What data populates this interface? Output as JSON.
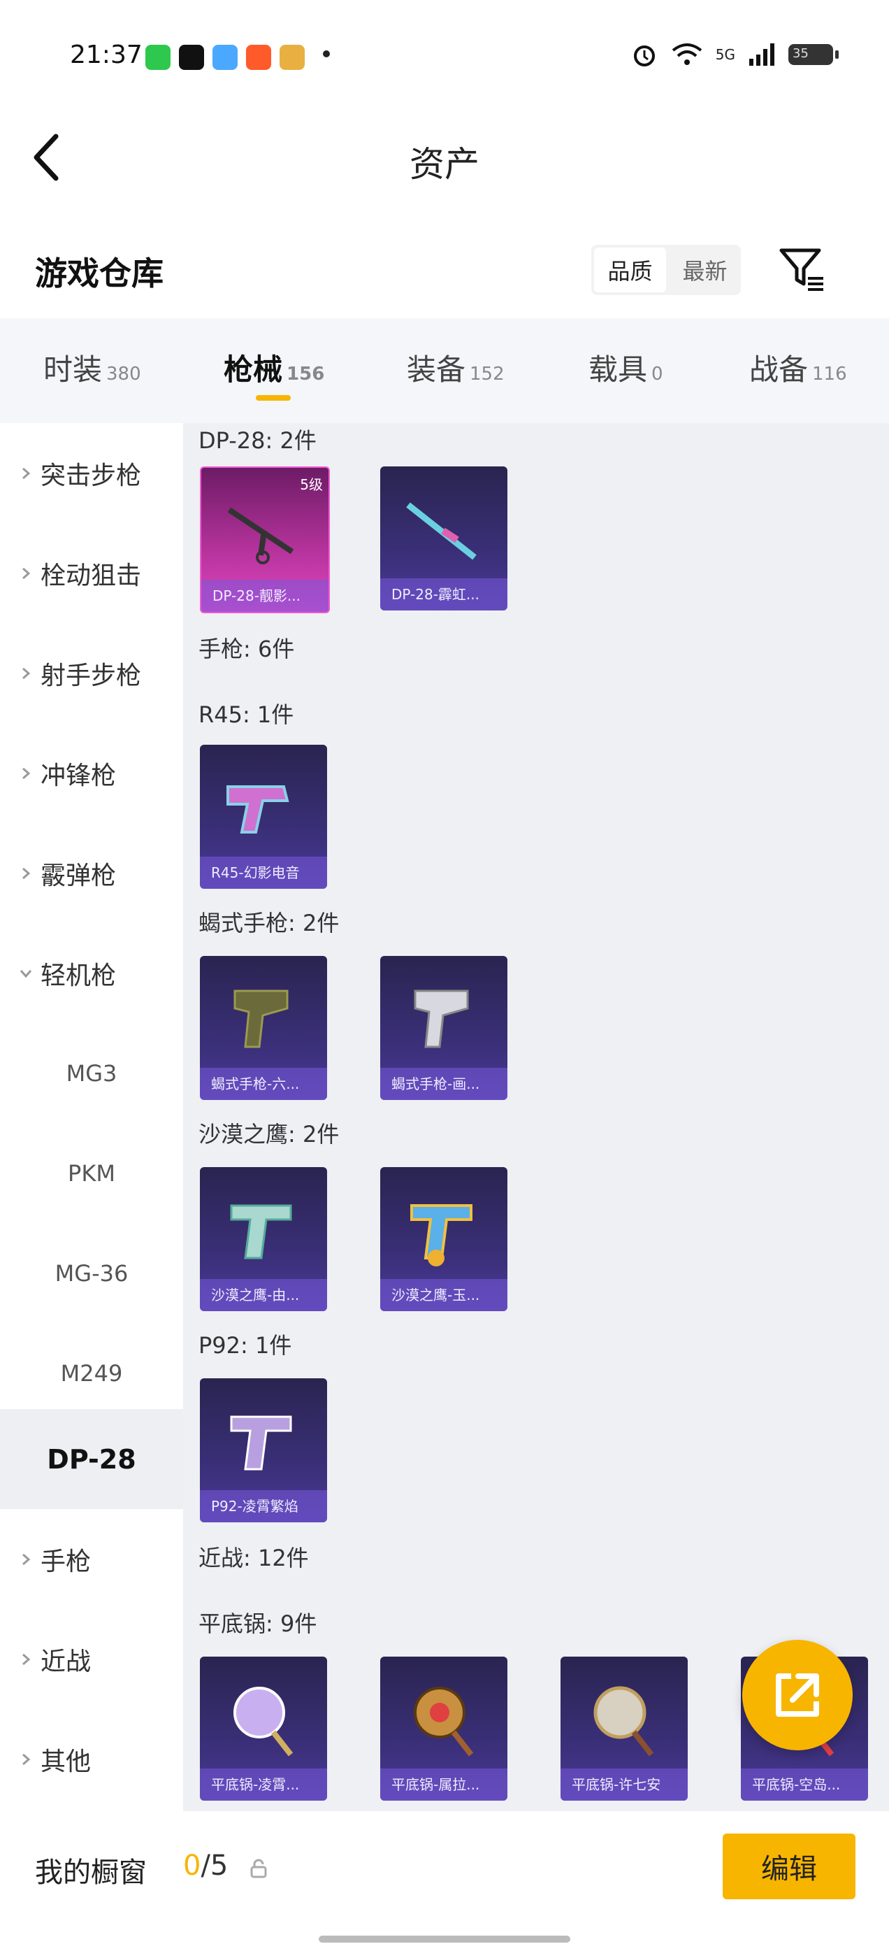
{
  "status_bar": {
    "time": "21:37",
    "network": "5G",
    "battery": "35"
  },
  "header": {
    "title": "资产"
  },
  "section": {
    "title": "游戏仓库",
    "sort_options": [
      "品质",
      "最新"
    ]
  },
  "tabs": [
    {
      "label": "时装",
      "count": "380"
    },
    {
      "label": "枪械",
      "count": "156"
    },
    {
      "label": "装备",
      "count": "152"
    },
    {
      "label": "载具",
      "count": "0"
    },
    {
      "label": "战备",
      "count": "116"
    }
  ],
  "sidebar": {
    "items": [
      "突击步枪",
      "栓动狙击",
      "射手步枪",
      "冲锋枪",
      "霰弹枪",
      "轻机枪",
      "MG3",
      "PKM",
      "MG-36",
      "M249",
      "DP-28",
      "手枪",
      "近战",
      "其他"
    ]
  },
  "content": {
    "groups": [
      {
        "label": "DP-28: 2件",
        "cards": [
          {
            "name": "DP-28-靓影...",
            "level": "5级"
          },
          {
            "name": "DP-28-霹虹..."
          }
        ]
      },
      {
        "label": "手枪: 6件",
        "cards": []
      },
      {
        "label": "R45: 1件",
        "cards": [
          {
            "name": "R45-幻影电音"
          }
        ]
      },
      {
        "label": "蝎式手枪: 2件",
        "cards": [
          {
            "name": "蝎式手枪-六..."
          },
          {
            "name": "蝎式手枪-画..."
          }
        ]
      },
      {
        "label": "沙漠之鹰: 2件",
        "cards": [
          {
            "name": "沙漠之鹰-由..."
          },
          {
            "name": "沙漠之鹰-玉..."
          }
        ]
      },
      {
        "label": "P92: 1件",
        "cards": [
          {
            "name": "P92-凌霄繁焰"
          }
        ]
      },
      {
        "label": "近战: 12件",
        "cards": []
      },
      {
        "label": "平底锅: 9件",
        "cards": [
          {
            "name": "平底锅-凌霄..."
          },
          {
            "name": "平底锅-属拉..."
          },
          {
            "name": "平底锅-许七安"
          },
          {
            "name": "平底锅-空岛..."
          }
        ]
      }
    ]
  },
  "bottom": {
    "window_label": "我的橱窗",
    "count_num": "0",
    "count_total": "/5",
    "edit_label": "编辑"
  },
  "colors": {
    "accent": "#f7b500",
    "card_bg": "#3a2f78",
    "card_pink": "#b8349e"
  }
}
